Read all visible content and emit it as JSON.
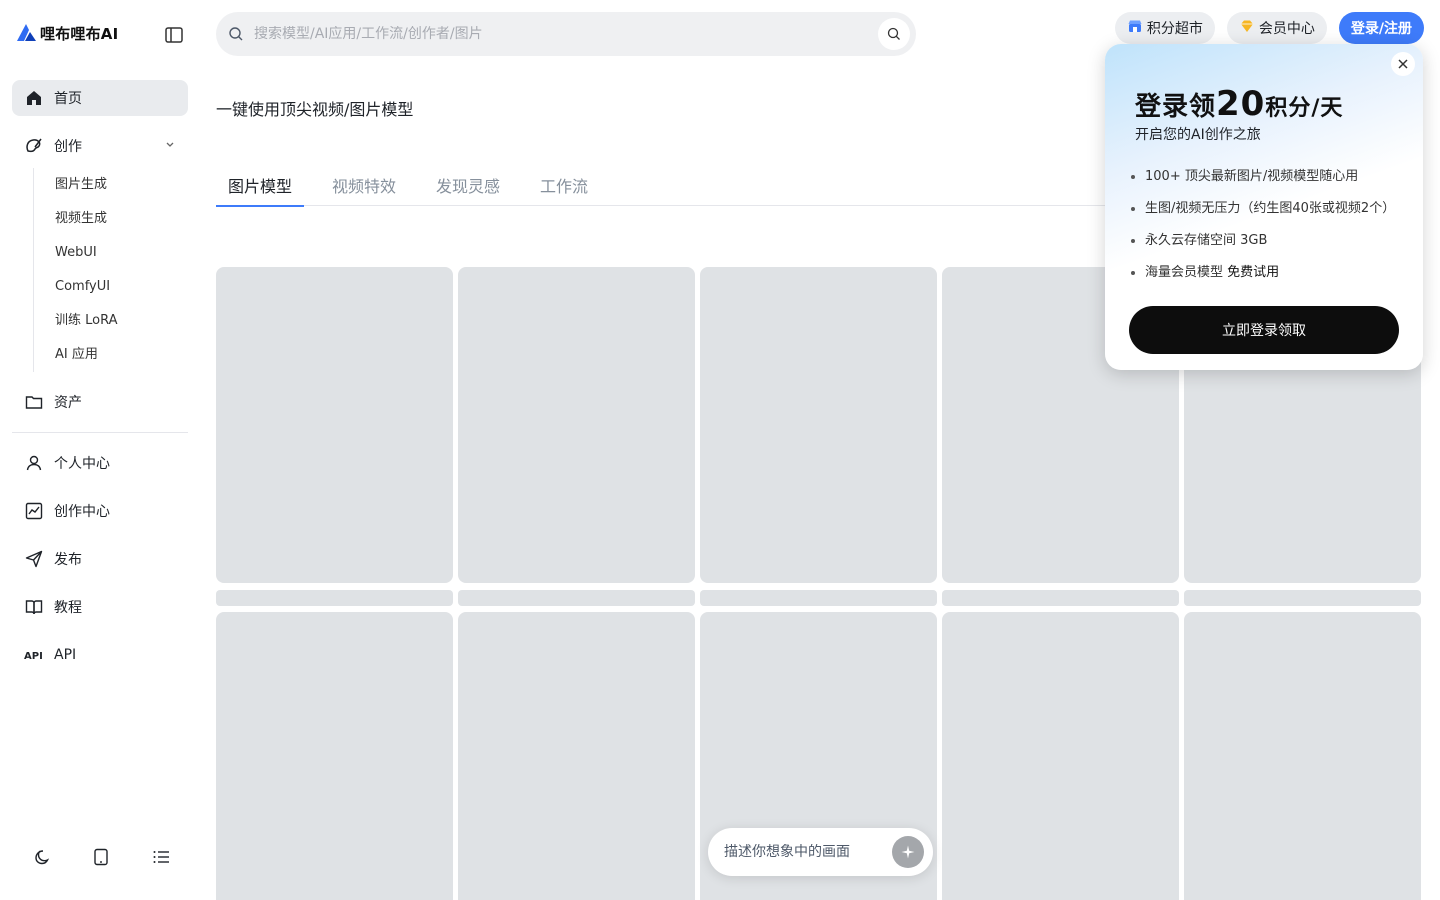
{
  "app": {
    "name": "哩布哩布AI"
  },
  "sidebar": {
    "items": [
      {
        "label": "首页",
        "icon": "home-icon",
        "active": true
      },
      {
        "label": "创作",
        "icon": "create-icon",
        "expanded": true,
        "children": [
          "图片生成",
          "视频生成",
          "WebUI",
          "ComfyUI",
          "训练 LoRA",
          "AI 应用"
        ]
      },
      {
        "label": "资产",
        "icon": "folder-icon"
      }
    ],
    "items2": [
      {
        "label": "个人中心",
        "icon": "user-icon"
      },
      {
        "label": "创作中心",
        "icon": "chart-icon"
      },
      {
        "label": "发布",
        "icon": "send-icon"
      },
      {
        "label": "教程",
        "icon": "book-icon"
      },
      {
        "label": "API",
        "icon": "api-icon"
      }
    ],
    "bottom_icons": [
      "moon-icon",
      "tablet-icon",
      "list-icon"
    ]
  },
  "search": {
    "placeholder": "搜索模型/AI应用/工作流/创作者/图片"
  },
  "header": {
    "points_mall": "积分超市",
    "vip_center": "会员中心",
    "login": "登录/注册"
  },
  "main": {
    "headline": "一键使用顶尖视频/图片模型",
    "tabs": [
      "图片模型",
      "视频特效",
      "发现灵感",
      "工作流"
    ],
    "active_tab": 0
  },
  "prompt": {
    "placeholder": "描述你想象中的画面"
  },
  "popup": {
    "title_prefix": "登录领",
    "title_number": "20",
    "title_suffix": "积分/天",
    "subtitle": "开启您的AI创作之旅",
    "benefits": [
      {
        "text": "100+ 顶尖最新图片/视频模型随心用",
        "strong": ""
      },
      {
        "text": "生图/视频无压力（约生图40张或视频2个）",
        "strong": ""
      },
      {
        "text": "永久云存储空间 3GB",
        "strong": ""
      },
      {
        "text": "海量会员模型 ",
        "strong": "免费试用"
      }
    ],
    "cta": "立即登录领取"
  },
  "colors": {
    "accent": "#3e7bfa",
    "placeholder_card": "#dfe2e5",
    "cta_bg": "#0d0d0d"
  }
}
